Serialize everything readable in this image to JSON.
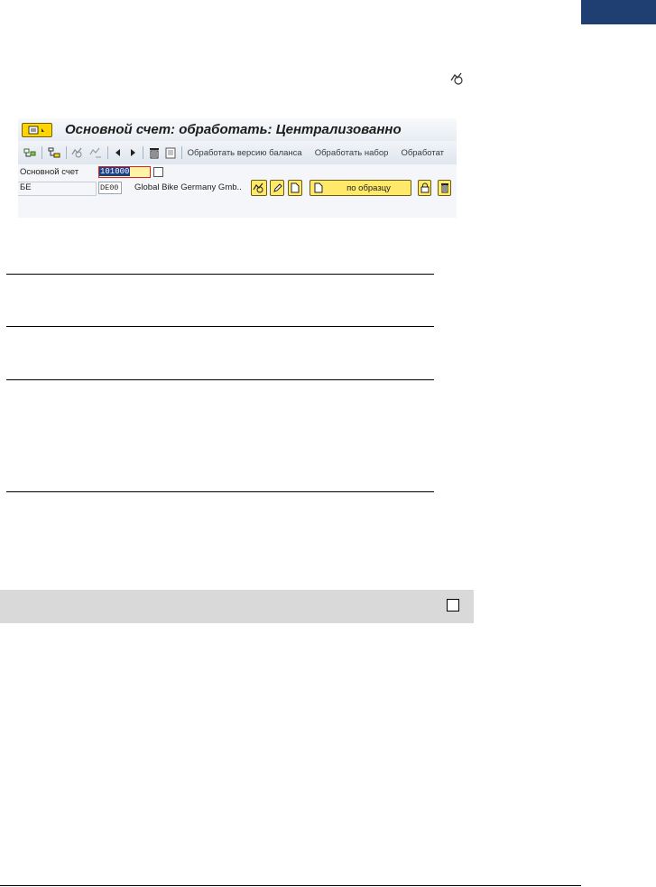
{
  "window": {
    "title": "Основной счет: обработать: Централизованно"
  },
  "toolbar": {
    "icons": [
      "tree-toggle-icon",
      "hierarchy-icon",
      "display-change-icon",
      "compare-icon",
      "previous-arrow-icon",
      "next-arrow-icon",
      "trash-icon",
      "document-icon"
    ],
    "edit_balance_version": "Обработать версию баланса",
    "edit_set": "Обработать набор",
    "edit_truncated": "Обработат"
  },
  "form": {
    "account_label": "Основной счет",
    "account_value": "101000",
    "company_label": "БЕ",
    "company_value": "DE00",
    "company_name": "Global Bike Germany Gmb..",
    "with_reference_label": "по образцу"
  },
  "colors": {
    "corner_tab": "#1f3f72",
    "title_gradient_top": "#f7f9fb",
    "menu_button": "#ffd500",
    "input_highlight": "#fff3a6",
    "selection": "#1a3f86",
    "gray_bar": "#d9d9d9"
  }
}
